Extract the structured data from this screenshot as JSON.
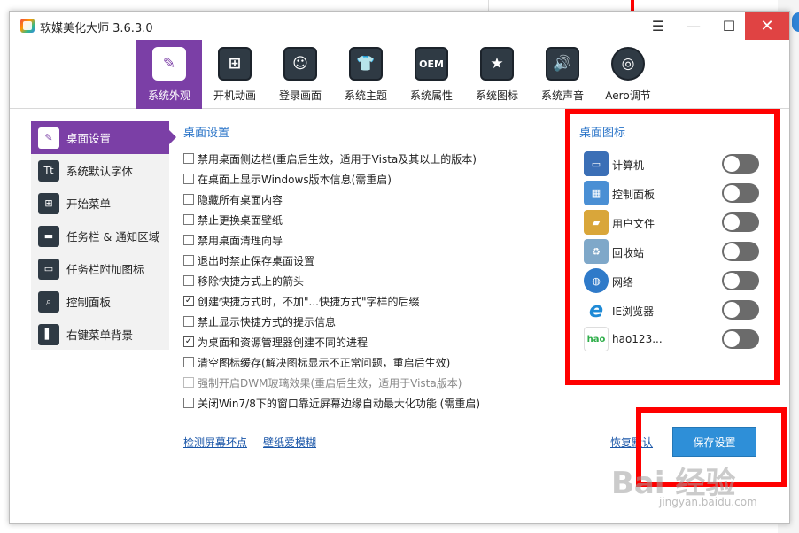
{
  "app": {
    "title": "软媒美化大师 3.6.3.0"
  },
  "window_controls": {
    "menu": "☰",
    "minimize": "—",
    "maximize": "☐",
    "close": "✕"
  },
  "toolbar": {
    "tabs": [
      {
        "label": "系统外观",
        "icon": "brush-icon",
        "glyph": "✎",
        "active": true
      },
      {
        "label": "开机动画",
        "icon": "windows-logo-icon",
        "glyph": "⊞",
        "active": false
      },
      {
        "label": "登录画面",
        "icon": "user-portrait-icon",
        "glyph": "☺",
        "active": false
      },
      {
        "label": "系统主题",
        "icon": "tshirt-icon",
        "glyph": "👕",
        "active": false
      },
      {
        "label": "系统属性",
        "icon": "oem-icon",
        "glyph": "OEM",
        "active": false
      },
      {
        "label": "系统图标",
        "icon": "star-icon",
        "glyph": "★",
        "active": false
      },
      {
        "label": "系统声音",
        "icon": "speaker-icon",
        "glyph": "🔊",
        "active": false
      },
      {
        "label": "Aero调节",
        "icon": "aero-circle-icon",
        "glyph": "◎",
        "active": false
      }
    ]
  },
  "sidebar": {
    "items": [
      {
        "label": "桌面设置",
        "icon": "wrench-icon",
        "glyph": "✎",
        "active": true
      },
      {
        "label": "系统默认字体",
        "icon": "font-icon",
        "glyph": "Tt",
        "active": false
      },
      {
        "label": "开始菜单",
        "icon": "start-menu-icon",
        "glyph": "⊞",
        "active": false
      },
      {
        "label": "任务栏 & 通知区域",
        "icon": "taskbar-icon",
        "glyph": "▬",
        "active": false
      },
      {
        "label": "任务栏附加图标",
        "icon": "taskbar-addon-icon",
        "glyph": "▭",
        "active": false
      },
      {
        "label": "控制面板",
        "icon": "search-panel-icon",
        "glyph": "⌕",
        "active": false
      },
      {
        "label": "右键菜单背景",
        "icon": "context-menu-icon",
        "glyph": "▌",
        "active": false
      }
    ]
  },
  "main": {
    "title": "桌面设置",
    "options": [
      {
        "label": "禁用桌面侧边栏(重启后生效，适用于Vista及其以上的版本)",
        "checked": false,
        "disabled": false
      },
      {
        "label": "在桌面上显示Windows版本信息(需重启)",
        "checked": false,
        "disabled": false
      },
      {
        "label": "隐藏所有桌面内容",
        "checked": false,
        "disabled": false
      },
      {
        "label": "禁止更换桌面壁纸",
        "checked": false,
        "disabled": false
      },
      {
        "label": "禁用桌面清理向导",
        "checked": false,
        "disabled": false
      },
      {
        "label": "退出时禁止保存桌面设置",
        "checked": false,
        "disabled": false
      },
      {
        "label": "移除快捷方式上的箭头",
        "checked": false,
        "disabled": false
      },
      {
        "label": "创建快捷方式时，不加\"...快捷方式\"字样的后缀",
        "checked": true,
        "disabled": false
      },
      {
        "label": "禁止显示快捷方式的提示信息",
        "checked": false,
        "disabled": false
      },
      {
        "label": "为桌面和资源管理器创建不同的进程",
        "checked": true,
        "disabled": false
      },
      {
        "label": "清空图标缓存(解决图标显示不正常问题，重启后生效)",
        "checked": false,
        "disabled": false
      },
      {
        "label": "强制开启DWM玻璃效果(重启后生效，适用于Vista版本)",
        "checked": false,
        "disabled": true
      },
      {
        "label": "关闭Win7/8下的窗口靠近屏幕边缘自动最大化功能 (需重启)",
        "checked": false,
        "disabled": false
      }
    ],
    "links": {
      "check_screen": "检测屏幕坏点",
      "wallpaper_blur": "壁纸爱模糊",
      "restore_default": "恢复默认"
    },
    "save_label": "保存设置"
  },
  "desktop_icons": {
    "title": "桌面图标",
    "items": [
      {
        "label": "计算机",
        "icon": "computer-icon",
        "glyph": "🖥",
        "enabled": false,
        "color": "#3b6fb6"
      },
      {
        "label": "控制面板",
        "icon": "control-panel-icon",
        "glyph": "▦",
        "enabled": false,
        "color": "#4a8fd4"
      },
      {
        "label": "用户文件",
        "icon": "user-folder-icon",
        "glyph": "📁",
        "enabled": false,
        "color": "#d9a63a"
      },
      {
        "label": "回收站",
        "icon": "recycle-bin-icon",
        "glyph": "♻",
        "enabled": false,
        "color": "#7fa8c9"
      },
      {
        "label": "网络",
        "icon": "network-icon",
        "glyph": "🌐",
        "enabled": false,
        "color": "#2f7ac9"
      },
      {
        "label": "IE浏览器",
        "icon": "ie-browser-icon",
        "glyph": "e",
        "enabled": false,
        "color": "#1e8ad6"
      },
      {
        "label": "hao123...",
        "icon": "hao123-icon",
        "glyph": "hao",
        "enabled": false,
        "color": "#2fae4a"
      }
    ]
  },
  "watermark": {
    "brand": "Bai 经验",
    "url": "jingyan.baidu.com"
  },
  "colors": {
    "accent": "#7b3fa6",
    "link": "#2a74c8",
    "save_button": "#2e8fd8",
    "close_button": "#e04343",
    "annotation": "#ff0000"
  }
}
